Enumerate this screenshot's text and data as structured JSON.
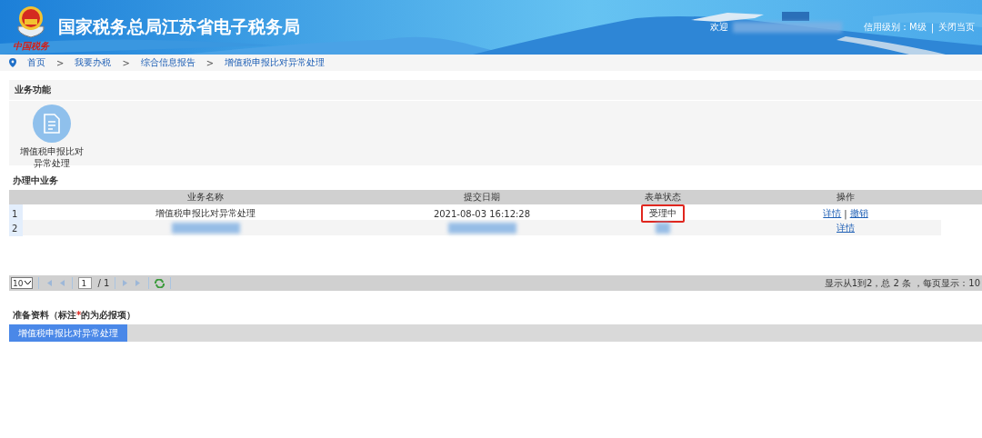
{
  "header": {
    "emblem_caption": "中国税务",
    "title": "国家税务总局江苏省电子税务局",
    "welcome": "欢迎",
    "user_blurred": true,
    "credit": "信用级别：M级",
    "separator": "|",
    "close": "关闭当页"
  },
  "breadcrumb": [
    {
      "label": "首页"
    },
    {
      "label": "我要办税"
    },
    {
      "label": "综合信息报告"
    },
    {
      "label": "增值税申报比对异常处理"
    }
  ],
  "breadcrumb_separator": ">",
  "functions": {
    "title": "业务功能",
    "items": [
      {
        "label": "增值税申报比对异常处理"
      }
    ]
  },
  "in_progress": {
    "title": "办理中业务",
    "columns": [
      "业务名称",
      "提交日期",
      "表单状态",
      "操作"
    ],
    "rows": [
      {
        "index": "1",
        "name": "增值税申报比对异常处理",
        "date": "2021-08-03 16:12:28",
        "status": "受理中",
        "status_highlighted": true,
        "blurred": false,
        "actions": [
          "详情",
          "撤销"
        ]
      },
      {
        "index": "2",
        "blurred": true,
        "status_highlighted": false,
        "actions": [
          "详情"
        ]
      }
    ],
    "action_separator": "|"
  },
  "pager": {
    "page_size": "10",
    "page": "1",
    "total_pages": "/ 1",
    "summary": "显示从1到2，总 2 条 ，每页显示：10"
  },
  "materials": {
    "title_before": "准备资料（标注",
    "required_mark": "*",
    "title_after": "的为必报项）",
    "tabs": [
      {
        "label": "增值税申报比对异常处理",
        "selected": true
      }
    ]
  }
}
